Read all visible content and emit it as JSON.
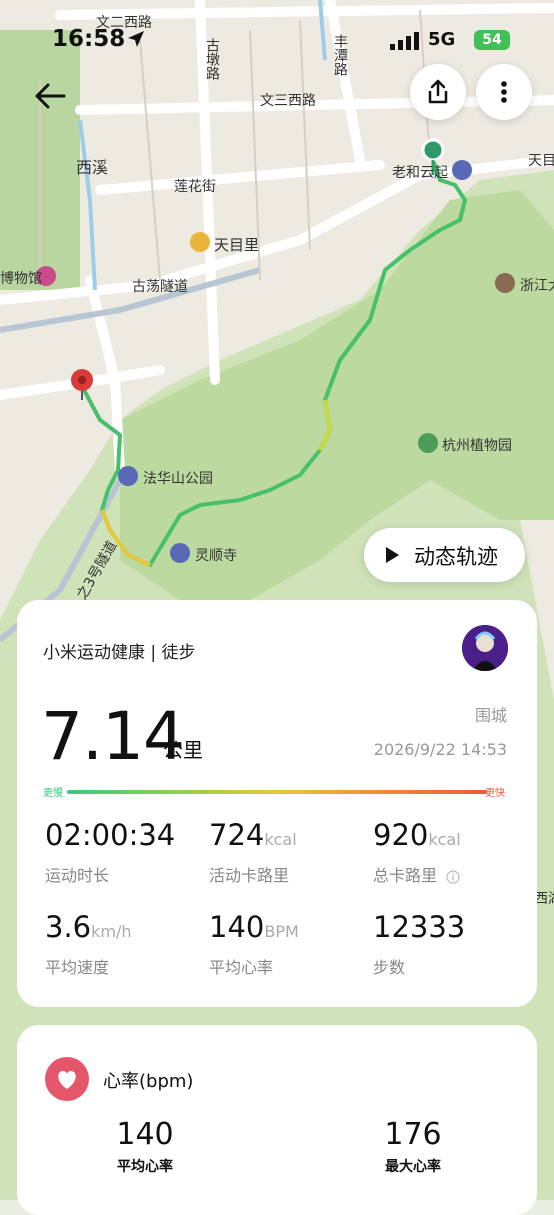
{
  "status_bar": {
    "time": "16:58",
    "network": "5G",
    "battery": "54"
  },
  "map": {
    "labels": {
      "road1": "文二西路",
      "road2": "古墩路",
      "road3": "文三西路",
      "road4": "丰潭路",
      "area1": "西溪",
      "road5": "莲花街",
      "road6": "古荡隧道",
      "road7": "之3号隧道",
      "edge1": "天目",
      "edge2": "西湖",
      "edge3": "博物馆"
    },
    "pois": {
      "start": "老和云起",
      "market": "天目里",
      "park": "法华山公园",
      "temple": "灵顺寺",
      "garden": "杭州植物园",
      "uni": "浙江大"
    },
    "playback_label": "动态轨迹"
  },
  "summary": {
    "brand": "小米运动健康 | 徒步",
    "distance": "7.14",
    "distance_unit": "公里",
    "city": "围城",
    "datetime": "2026/9/22 14:53",
    "slow_label": "更慢",
    "fast_label": "更快",
    "stats": [
      {
        "value": "02:00:34",
        "unit": "",
        "label": "运动时长"
      },
      {
        "value": "724",
        "unit": "kcal",
        "label": "活动卡路里"
      },
      {
        "value": "920",
        "unit": "kcal",
        "label": "总卡路里"
      },
      {
        "value": "3.6",
        "unit": "km/h",
        "label": "平均速度"
      },
      {
        "value": "140",
        "unit": "BPM",
        "label": "平均心率"
      },
      {
        "value": "12333",
        "unit": "",
        "label": "步数"
      }
    ]
  },
  "heart_rate": {
    "title": "心率(bpm)",
    "avg_value": "140",
    "avg_label": "平均心率",
    "max_value": "176",
    "max_label": "最大心率"
  },
  "colors": {
    "route_fast": "#ea5a3a",
    "route_slow": "#3cc783",
    "route_mid": "#e6c93a",
    "heart": "#e5566a"
  },
  "icons": {
    "back": "arrow-left-icon",
    "share": "share-icon",
    "more": "more-vertical-icon",
    "play": "play-icon",
    "heart": "heart-icon",
    "info": "info-icon"
  }
}
